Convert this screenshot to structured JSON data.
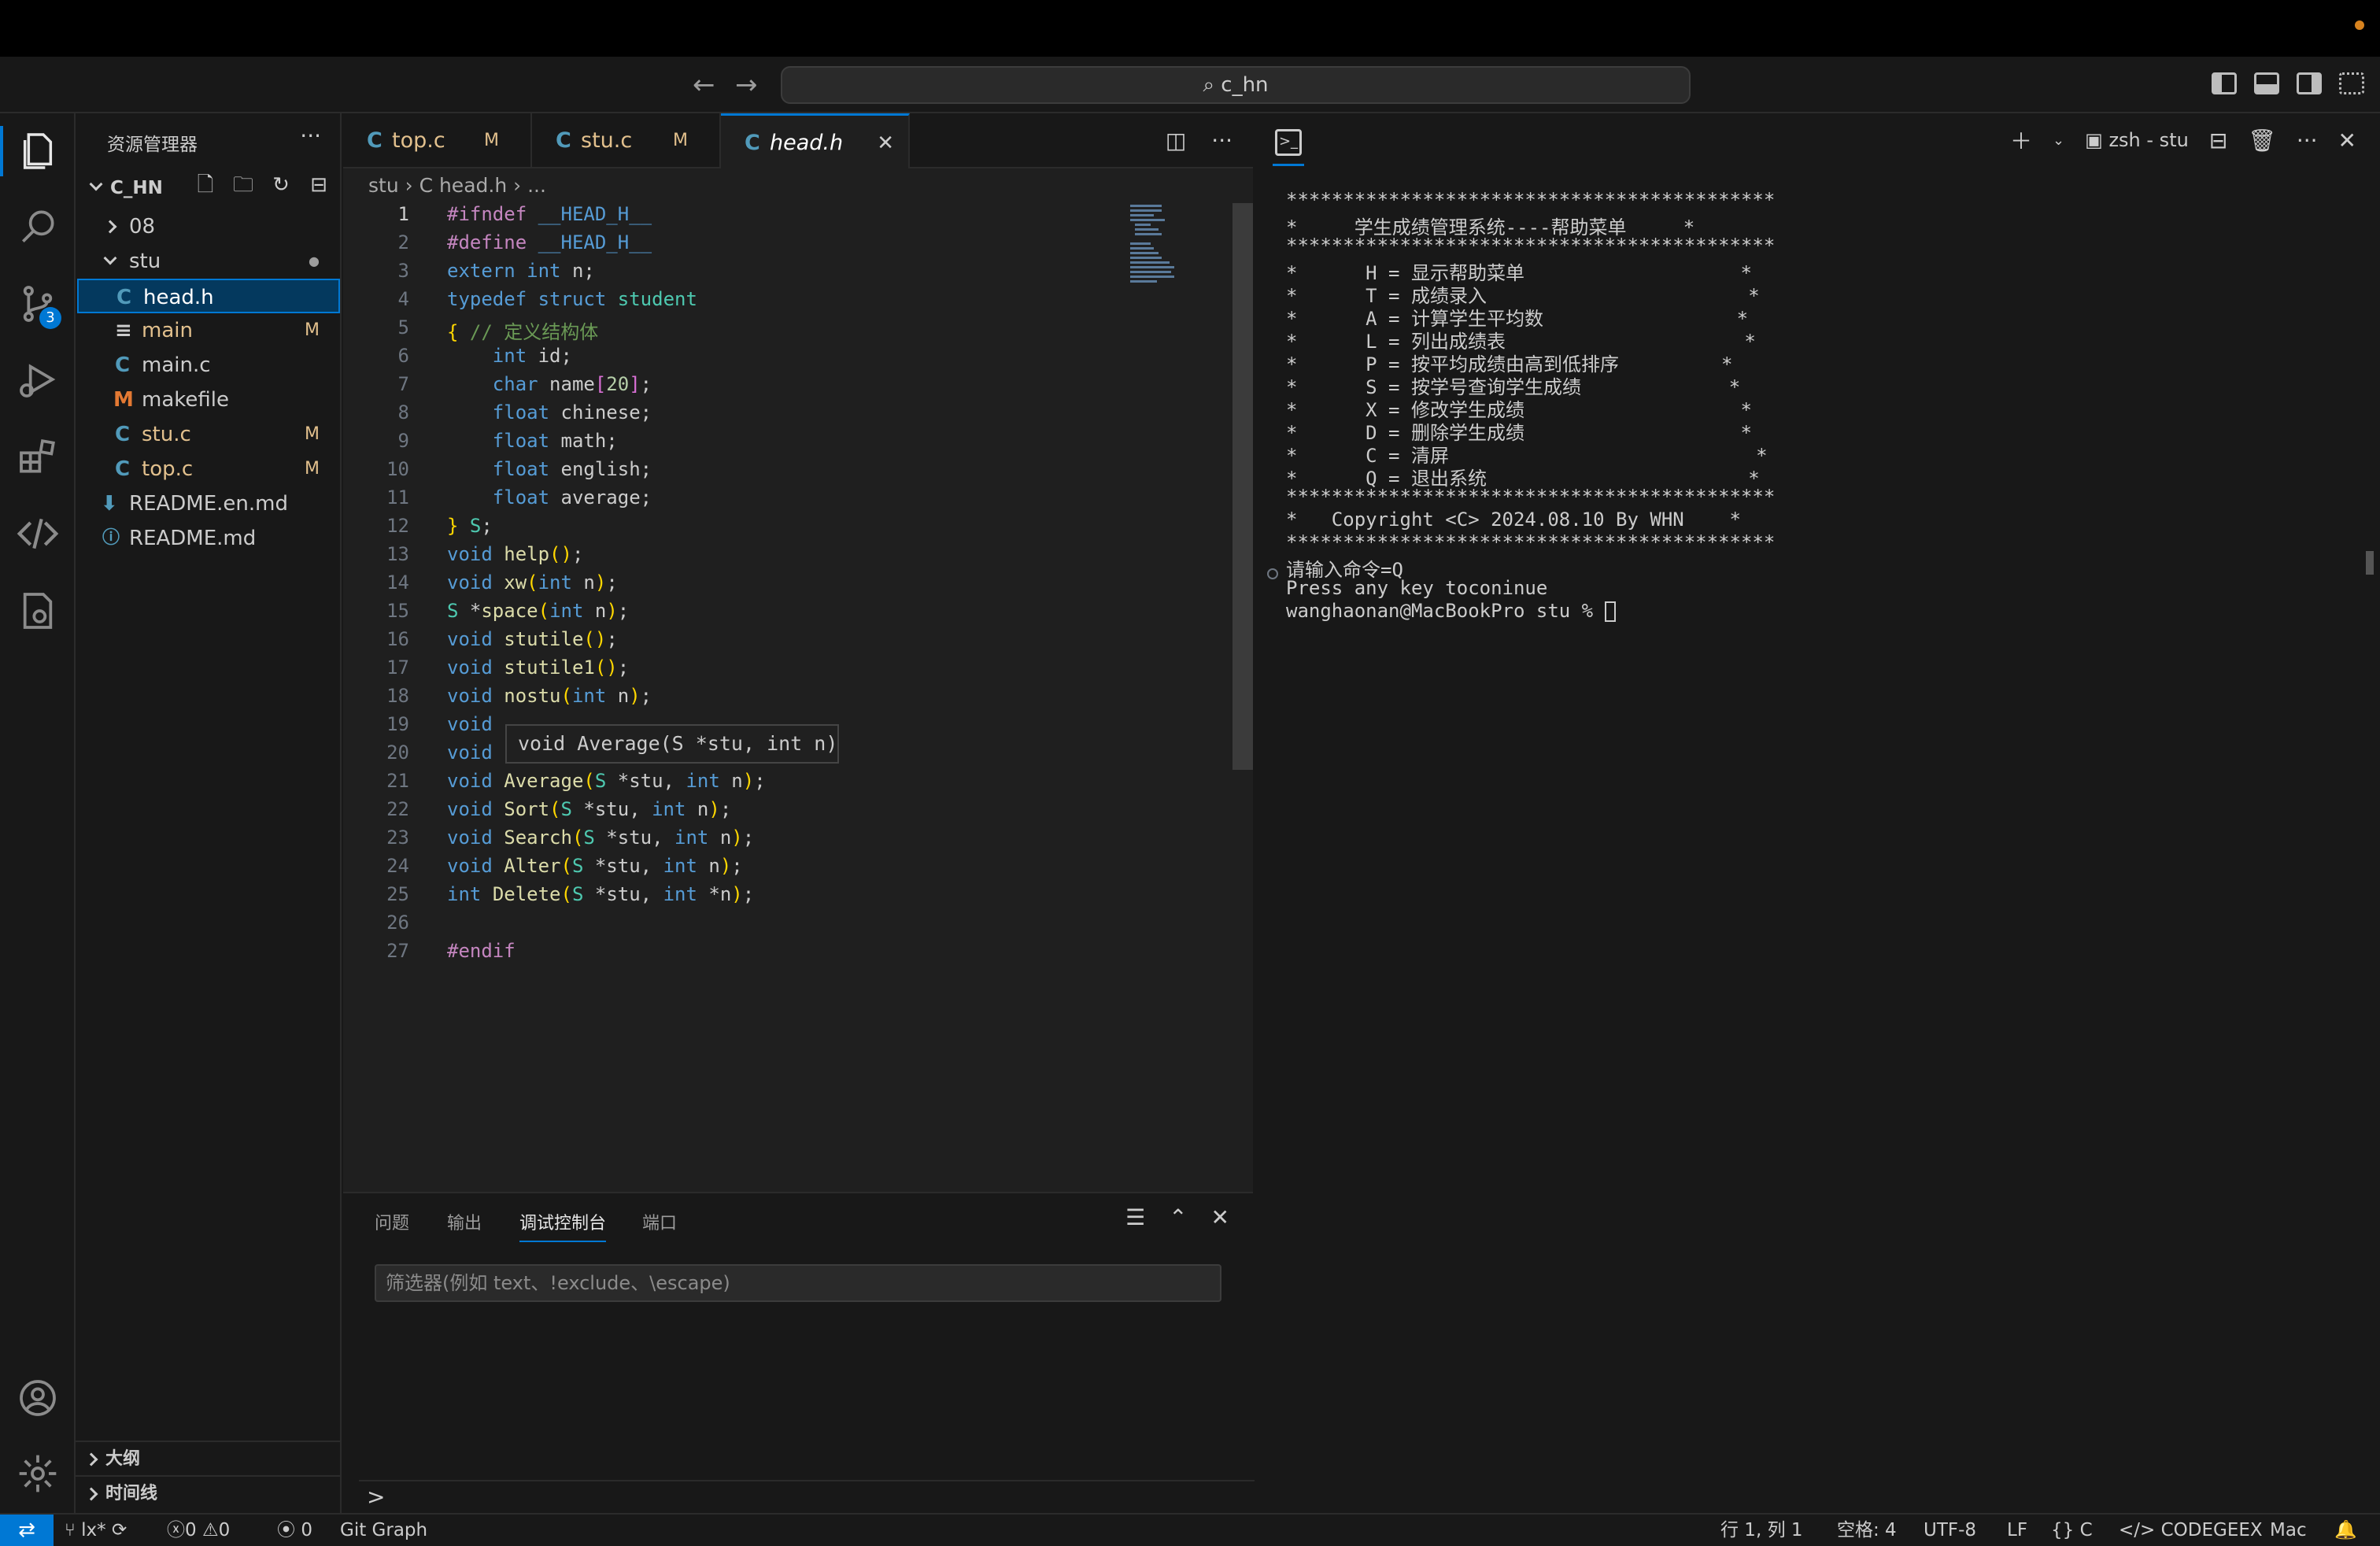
{
  "title": {
    "search": "c_hn"
  },
  "sidebar": {
    "title": "资源管理器",
    "root": "C_HN",
    "items": [
      {
        "name": "08",
        "kind": "folder",
        "status": ""
      },
      {
        "name": "stu",
        "kind": "folder",
        "status": "●"
      },
      {
        "name": "head.h",
        "kind": "c",
        "status": ""
      },
      {
        "name": "main",
        "kind": "text",
        "status": "M"
      },
      {
        "name": "main.c",
        "kind": "c",
        "status": ""
      },
      {
        "name": "makefile",
        "kind": "make",
        "status": ""
      },
      {
        "name": "stu.c",
        "kind": "c",
        "status": "M"
      },
      {
        "name": "top.c",
        "kind": "c",
        "status": "M"
      },
      {
        "name": "README.en.md",
        "kind": "md",
        "status": ""
      },
      {
        "name": "README.md",
        "kind": "info",
        "status": ""
      }
    ],
    "outline": "大纲",
    "timeline": "时间线"
  },
  "tabs": [
    {
      "label": "top.c",
      "icon": "C",
      "status": "M"
    },
    {
      "label": "stu.c",
      "icon": "C",
      "status": "M"
    },
    {
      "label": "head.h",
      "icon": "C",
      "status": ""
    }
  ],
  "breadcrumb": "stu › C head.h › ...",
  "editor": {
    "hover": "void Average(S *stu, int n)",
    "line_numbers": [
      "1",
      "2",
      "3",
      "4",
      "5",
      "6",
      "7",
      "8",
      "9",
      "10",
      "11",
      "12",
      "13",
      "14",
      "15",
      "16",
      "17",
      "18",
      "19",
      "20",
      "21",
      "22",
      "23",
      "24",
      "25",
      "26",
      "27"
    ]
  },
  "panel": {
    "tabs": [
      "问题",
      "输出",
      "调试控制台",
      "端口"
    ],
    "filter_placeholder": "筛选器(例如 text、!exclude、\\escape)",
    "prompt": ">"
  },
  "terminal": {
    "tab_label": "zsh - stu",
    "lines": [
      "*******************************************",
      "*     学生成绩管理系统----帮助菜单     *",
      "*******************************************",
      "*      H = 显示帮助菜单                   *",
      "*      T = 成绩录入                       *",
      "*      A = 计算学生平均数                 *",
      "*      L = 列出成绩表                     *",
      "*      P = 按平均成绩由高到低排序         *",
      "*      S = 按学号查询学生成绩             *",
      "*      X = 修改学生成绩                   *",
      "*      D = 删除学生成绩                   *",
      "*      C = 清屏                           *",
      "*      Q = 退出系统                       *",
      "*******************************************",
      "*   Copyright <C> 2024.08.10 By WHN    *",
      "*******************************************",
      "请输入命令=Q",
      "Press any key toconinue"
    ],
    "prompt": "wanghaonan@MacBookPro stu % "
  },
  "status": {
    "branch": "lx*",
    "errors": "0",
    "warnings": "0",
    "ports": "0",
    "gitgraph": "Git Graph",
    "position": "行 1, 列 1",
    "spaces": "空格: 4",
    "encoding": "UTF-8",
    "eol": "LF",
    "language": "C",
    "codegeex": "CODEGEEX",
    "platform": "Mac"
  },
  "badges": {
    "scm": "3"
  },
  "colors": {
    "accent": "#0078d4",
    "modified": "#e2c08d",
    "background": "#1f1f1f"
  }
}
